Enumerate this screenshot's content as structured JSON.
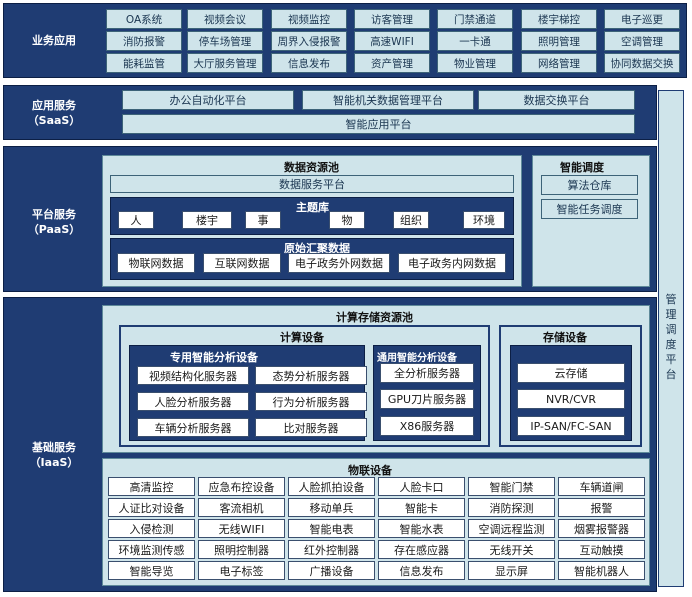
{
  "business": {
    "label": [
      "业务应用"
    ],
    "items": [
      [
        "OA系统",
        "视频会议",
        "视频监控",
        "访客管理",
        "门禁通道",
        "楼宇梯控",
        "电子巡更"
      ],
      [
        "消防报警",
        "停车场管理",
        "周界入侵报警",
        "高速WIFI",
        "一卡通",
        "照明管理",
        "空调管理"
      ],
      [
        "能耗监管",
        "大厅服务管理",
        "信息发布",
        "资产管理",
        "物业管理",
        "网络管理",
        "协同数据交换"
      ]
    ]
  },
  "saas": {
    "label": [
      "应用服务",
      "（SaaS）"
    ],
    "row1": [
      "办公自动化平台",
      "智能机关数据管理平台",
      "数据交换平台"
    ],
    "row2": "智能应用平台"
  },
  "paas": {
    "label": [
      "平台服务",
      "（PaaS）"
    ],
    "pool_title": "数据资源池",
    "data_service": "数据服务平台",
    "theme_title": "主题库",
    "themes": [
      "人",
      "楼宇",
      "事",
      "物",
      "组织",
      "环境"
    ],
    "raw_title": "原始汇聚数据",
    "raw": [
      "物联网数据",
      "互联网数据",
      "电子政务外网数据",
      "电子政务内网数据"
    ],
    "sched_title": "智能调度",
    "sched": [
      "算法仓库",
      "智能任务调度"
    ]
  },
  "iaas": {
    "label": [
      "基础服务",
      "（IaaS）"
    ],
    "pool_title": "计算存储资源池",
    "compute_title": "计算设备",
    "special_title": "专用智能分析设备",
    "special": [
      "视频结构化服务器",
      "态势分析服务器",
      "人脸分析服务器",
      "行为分析服务器",
      "车辆分析服务器",
      "比对服务器"
    ],
    "general_title": "通用智能分析设备",
    "general": [
      "全分析服务器",
      "GPU刀片服务器",
      "X86服务器"
    ],
    "storage_title": "存储设备",
    "storage": [
      "云存储",
      "NVR/CVR",
      "IP-SAN/FC-SAN"
    ],
    "iot_title": "物联设备",
    "iot": [
      [
        "高清监控",
        "应急布控设备",
        "人脸抓拍设备",
        "人脸卡口",
        "智能门禁",
        "车辆道闸"
      ],
      [
        "人证比对设备",
        "客流相机",
        "移动单兵",
        "智能卡",
        "消防探测",
        "报警"
      ],
      [
        "入侵检测",
        "无线WIFI",
        "智能电表",
        "智能水表",
        "空调远程监测",
        "烟雾报警器"
      ],
      [
        "环境监测传感",
        "照明控制器",
        "红外控制器",
        "存在感应器",
        "无线开关",
        "互动触摸"
      ],
      [
        "智能导览",
        "电子标签",
        "广播设备",
        "信息发布",
        "显示屏",
        "智能机器人"
      ]
    ]
  },
  "side": [
    "管",
    "理",
    "调",
    "度",
    "平",
    "台"
  ]
}
